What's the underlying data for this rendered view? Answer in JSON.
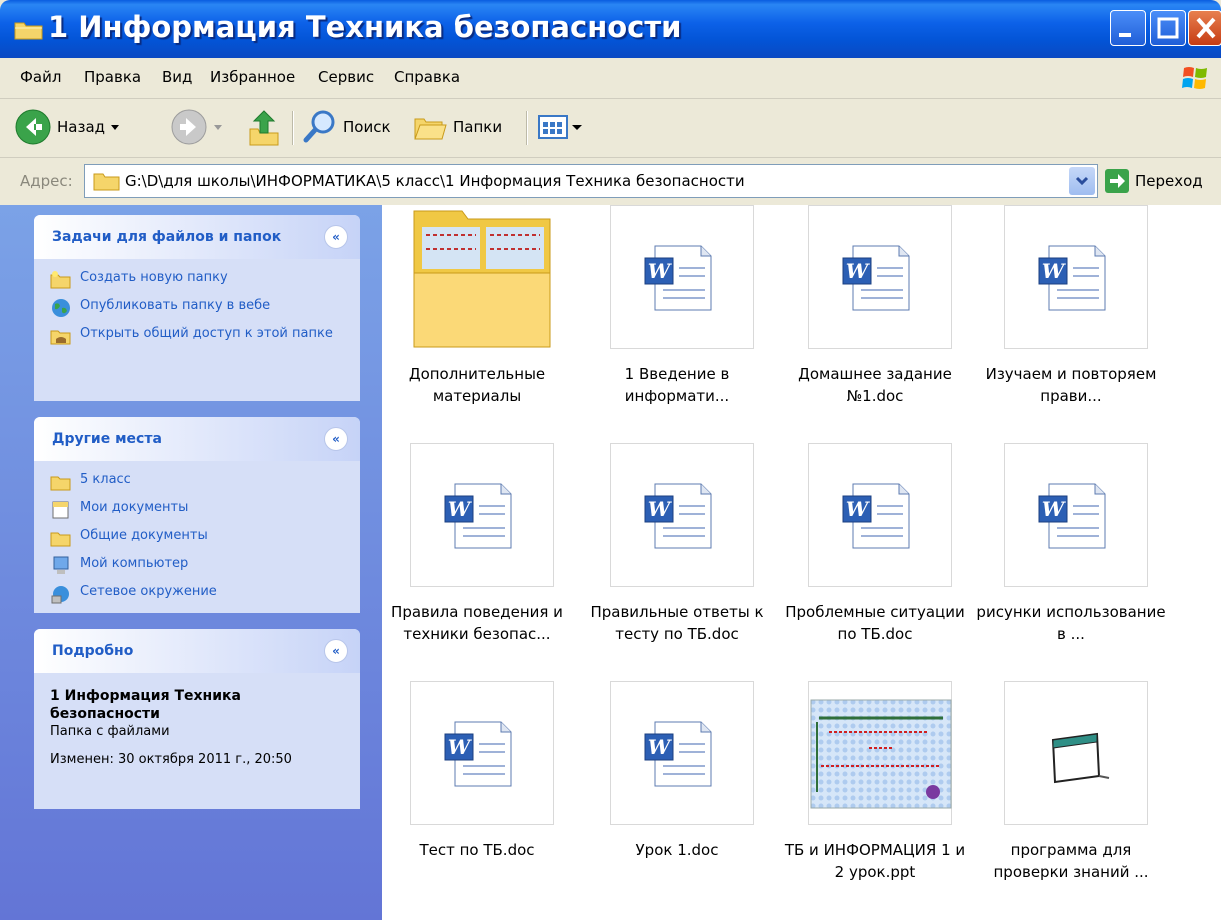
{
  "window": {
    "title": "1 Информация Техника безопасности"
  },
  "menu": [
    "Файл",
    "Правка",
    "Вид",
    "Избранное",
    "Сервис",
    "Справка"
  ],
  "toolbar": {
    "back": "Назад",
    "search": "Поиск",
    "folders": "Папки"
  },
  "address": {
    "label": "Адрес:",
    "path": "G:\\D\\для школы\\ИНФОРМАТИКА\\5 класс\\1 Информация Техника безопасности",
    "go": "Переход"
  },
  "panels": {
    "tasks": {
      "title": "Задачи для файлов и папок",
      "items": [
        "Создать новую папку",
        "Опубликовать папку в вебе",
        "Открыть общий доступ к этой папке"
      ]
    },
    "places": {
      "title": "Другие места",
      "items": [
        "5 класс",
        "Мои документы",
        "Общие документы",
        "Мой компьютер",
        "Сетевое окружение"
      ]
    },
    "details": {
      "title": "Подробно",
      "name": "1 Информация Техника безопасности",
      "type": "Папка с файлами",
      "modified": "Изменен: 30 октября 2011 г., 20:50"
    }
  },
  "files": [
    {
      "name": "Дополнительные материалы",
      "kind": "folder"
    },
    {
      "name": "1 Введение в информати...",
      "kind": "doc"
    },
    {
      "name": "Домашнее задание №1.doc",
      "kind": "doc"
    },
    {
      "name": "Изучаем и повторяем прави...",
      "kind": "doc"
    },
    {
      "name": "Правила поведения и техники безопас...",
      "kind": "doc"
    },
    {
      "name": "Правильные ответы к тесту  по ТБ.doc",
      "kind": "doc"
    },
    {
      "name": "Проблемные ситуации по ТБ.doc",
      "kind": "doc"
    },
    {
      "name": "рисунки использование в ...",
      "kind": "doc"
    },
    {
      "name": "Тест по ТБ.doc",
      "kind": "doc"
    },
    {
      "name": "Урок 1.doc",
      "kind": "doc"
    },
    {
      "name": "ТБ и ИНФОРМАЦИЯ 1 и 2 урок.ppt",
      "kind": "ppt"
    },
    {
      "name": "программа для проверки знаний ...",
      "kind": "program"
    }
  ],
  "colors": {
    "titlebar": "#0354d6",
    "link": "#215dc6",
    "sidebar": "#7ba2e7"
  }
}
